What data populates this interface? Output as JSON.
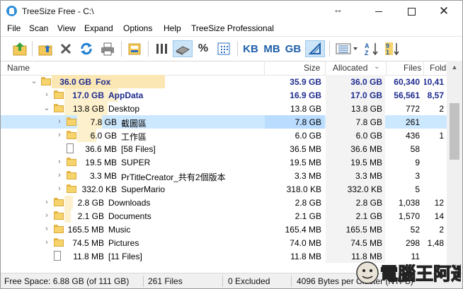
{
  "window": {
    "title": "TreeSize Free - C:\\",
    "controls": {
      "minimize": "minimize",
      "maximize": "maximize",
      "close": "✕"
    },
    "resize_glyph": "↔"
  },
  "menu": [
    "File",
    "Scan",
    "View",
    "Expand",
    "Options",
    "Help",
    "TreeSize Professional"
  ],
  "toolbar": {
    "units": [
      "KB",
      "MB",
      "GB"
    ],
    "percent": "%",
    "icons": [
      "scan-folder-icon",
      "select-drive-icon",
      "stop-icon",
      "refresh-icon",
      "print-icon",
      "export-icon",
      "bar-view-icon",
      "size-view-icon",
      "percent-view-icon",
      "files-view-icon",
      "kb-unit-icon",
      "mb-unit-icon",
      "gb-unit-icon",
      "auto-unit-icon",
      "columns-icon",
      "sort-az-icon",
      "sort-size-icon"
    ]
  },
  "columns": {
    "name": "Name",
    "size": "Size",
    "allocated": "Allocated",
    "files": "Files",
    "folders": "Fold..."
  },
  "rows": [
    {
      "level": 0,
      "expanded": true,
      "type": "folder",
      "size_label": "36.0 GB",
      "name": "Fox",
      "size": "35.9 GB",
      "allocated": "36.0 GB",
      "files": "60,340",
      "folders": "10,41",
      "bold": true
    },
    {
      "level": 1,
      "expanded": false,
      "type": "folder",
      "size_label": "17.0 GB",
      "name": "AppData",
      "size": "16.9 GB",
      "allocated": "17.0 GB",
      "files": "56,561",
      "folders": "8,57",
      "bold": true
    },
    {
      "level": 1,
      "expanded": true,
      "type": "folder",
      "size_label": "13.8 GB",
      "name": "Desktop",
      "size": "13.8 GB",
      "allocated": "13.8 GB",
      "files": "772",
      "folders": "2",
      "bold": false
    },
    {
      "level": 2,
      "expanded": false,
      "type": "folder",
      "size_label": "7.8 GB",
      "name": "截圖區",
      "size": "7.8 GB",
      "allocated": "7.8 GB",
      "files": "261",
      "folders": "",
      "bold": false,
      "selected": true
    },
    {
      "level": 2,
      "expanded": false,
      "type": "folder",
      "size_label": "6.0 GB",
      "name": "工作區",
      "size": "6.0 GB",
      "allocated": "6.0 GB",
      "files": "436",
      "folders": "1",
      "bold": false
    },
    {
      "level": 2,
      "expanded": null,
      "type": "file",
      "size_label": "36.6 MB",
      "name": "[58 Files]",
      "size": "36.5 MB",
      "allocated": "36.6 MB",
      "files": "58",
      "folders": "",
      "bold": false
    },
    {
      "level": 2,
      "expanded": false,
      "type": "folder",
      "size_label": "19.5 MB",
      "name": "SUPER",
      "size": "19.5 MB",
      "allocated": "19.5 MB",
      "files": "9",
      "folders": "",
      "bold": false
    },
    {
      "level": 2,
      "expanded": false,
      "type": "folder",
      "size_label": "3.3 MB",
      "name": "PrTitleCreator_共有2個版本",
      "size": "3.3 MB",
      "allocated": "3.3 MB",
      "files": "3",
      "folders": "",
      "bold": false
    },
    {
      "level": 2,
      "expanded": false,
      "type": "folder",
      "size_label": "332.0 KB",
      "name": "SuperMario",
      "size": "318.0 KB",
      "allocated": "332.0 KB",
      "files": "5",
      "folders": "",
      "bold": false
    },
    {
      "level": 1,
      "expanded": false,
      "type": "folder",
      "size_label": "2.8 GB",
      "name": "Downloads",
      "size": "2.8 GB",
      "allocated": "2.8 GB",
      "files": "1,038",
      "folders": "12",
      "bold": false
    },
    {
      "level": 1,
      "expanded": false,
      "type": "folder",
      "size_label": "2.1 GB",
      "name": "Documents",
      "size": "2.1 GB",
      "allocated": "2.1 GB",
      "files": "1,570",
      "folders": "14",
      "bold": false
    },
    {
      "level": 1,
      "expanded": false,
      "type": "folder",
      "size_label": "165.5 MB",
      "name": "Music",
      "size": "165.4 MB",
      "allocated": "165.5 MB",
      "files": "52",
      "folders": "2",
      "bold": false
    },
    {
      "level": 1,
      "expanded": false,
      "type": "folder",
      "size_label": "74.5 MB",
      "name": "Pictures",
      "size": "74.0 MB",
      "allocated": "74.5 MB",
      "files": "298",
      "folders": "1,48",
      "bold": false
    },
    {
      "level": 1,
      "expanded": null,
      "type": "file",
      "size_label": "11.8 MB",
      "name": "[11 Files]",
      "size": "11.8 MB",
      "allocated": "11.8 MB",
      "files": "11",
      "folders": "",
      "bold": false
    }
  ],
  "status": {
    "free_space": "Free Space: 6.88 GB  (of 111 GB)",
    "files": "261  Files",
    "excluded": "0 Excluded",
    "cluster": "4096  Bytes per Cluster (NTFS)"
  },
  "watermark": "電腦王阿達",
  "colors": {
    "accent": "#1f5fa8",
    "selected_row": "#cce8ff",
    "bar_fill": "#fbe7b4"
  }
}
